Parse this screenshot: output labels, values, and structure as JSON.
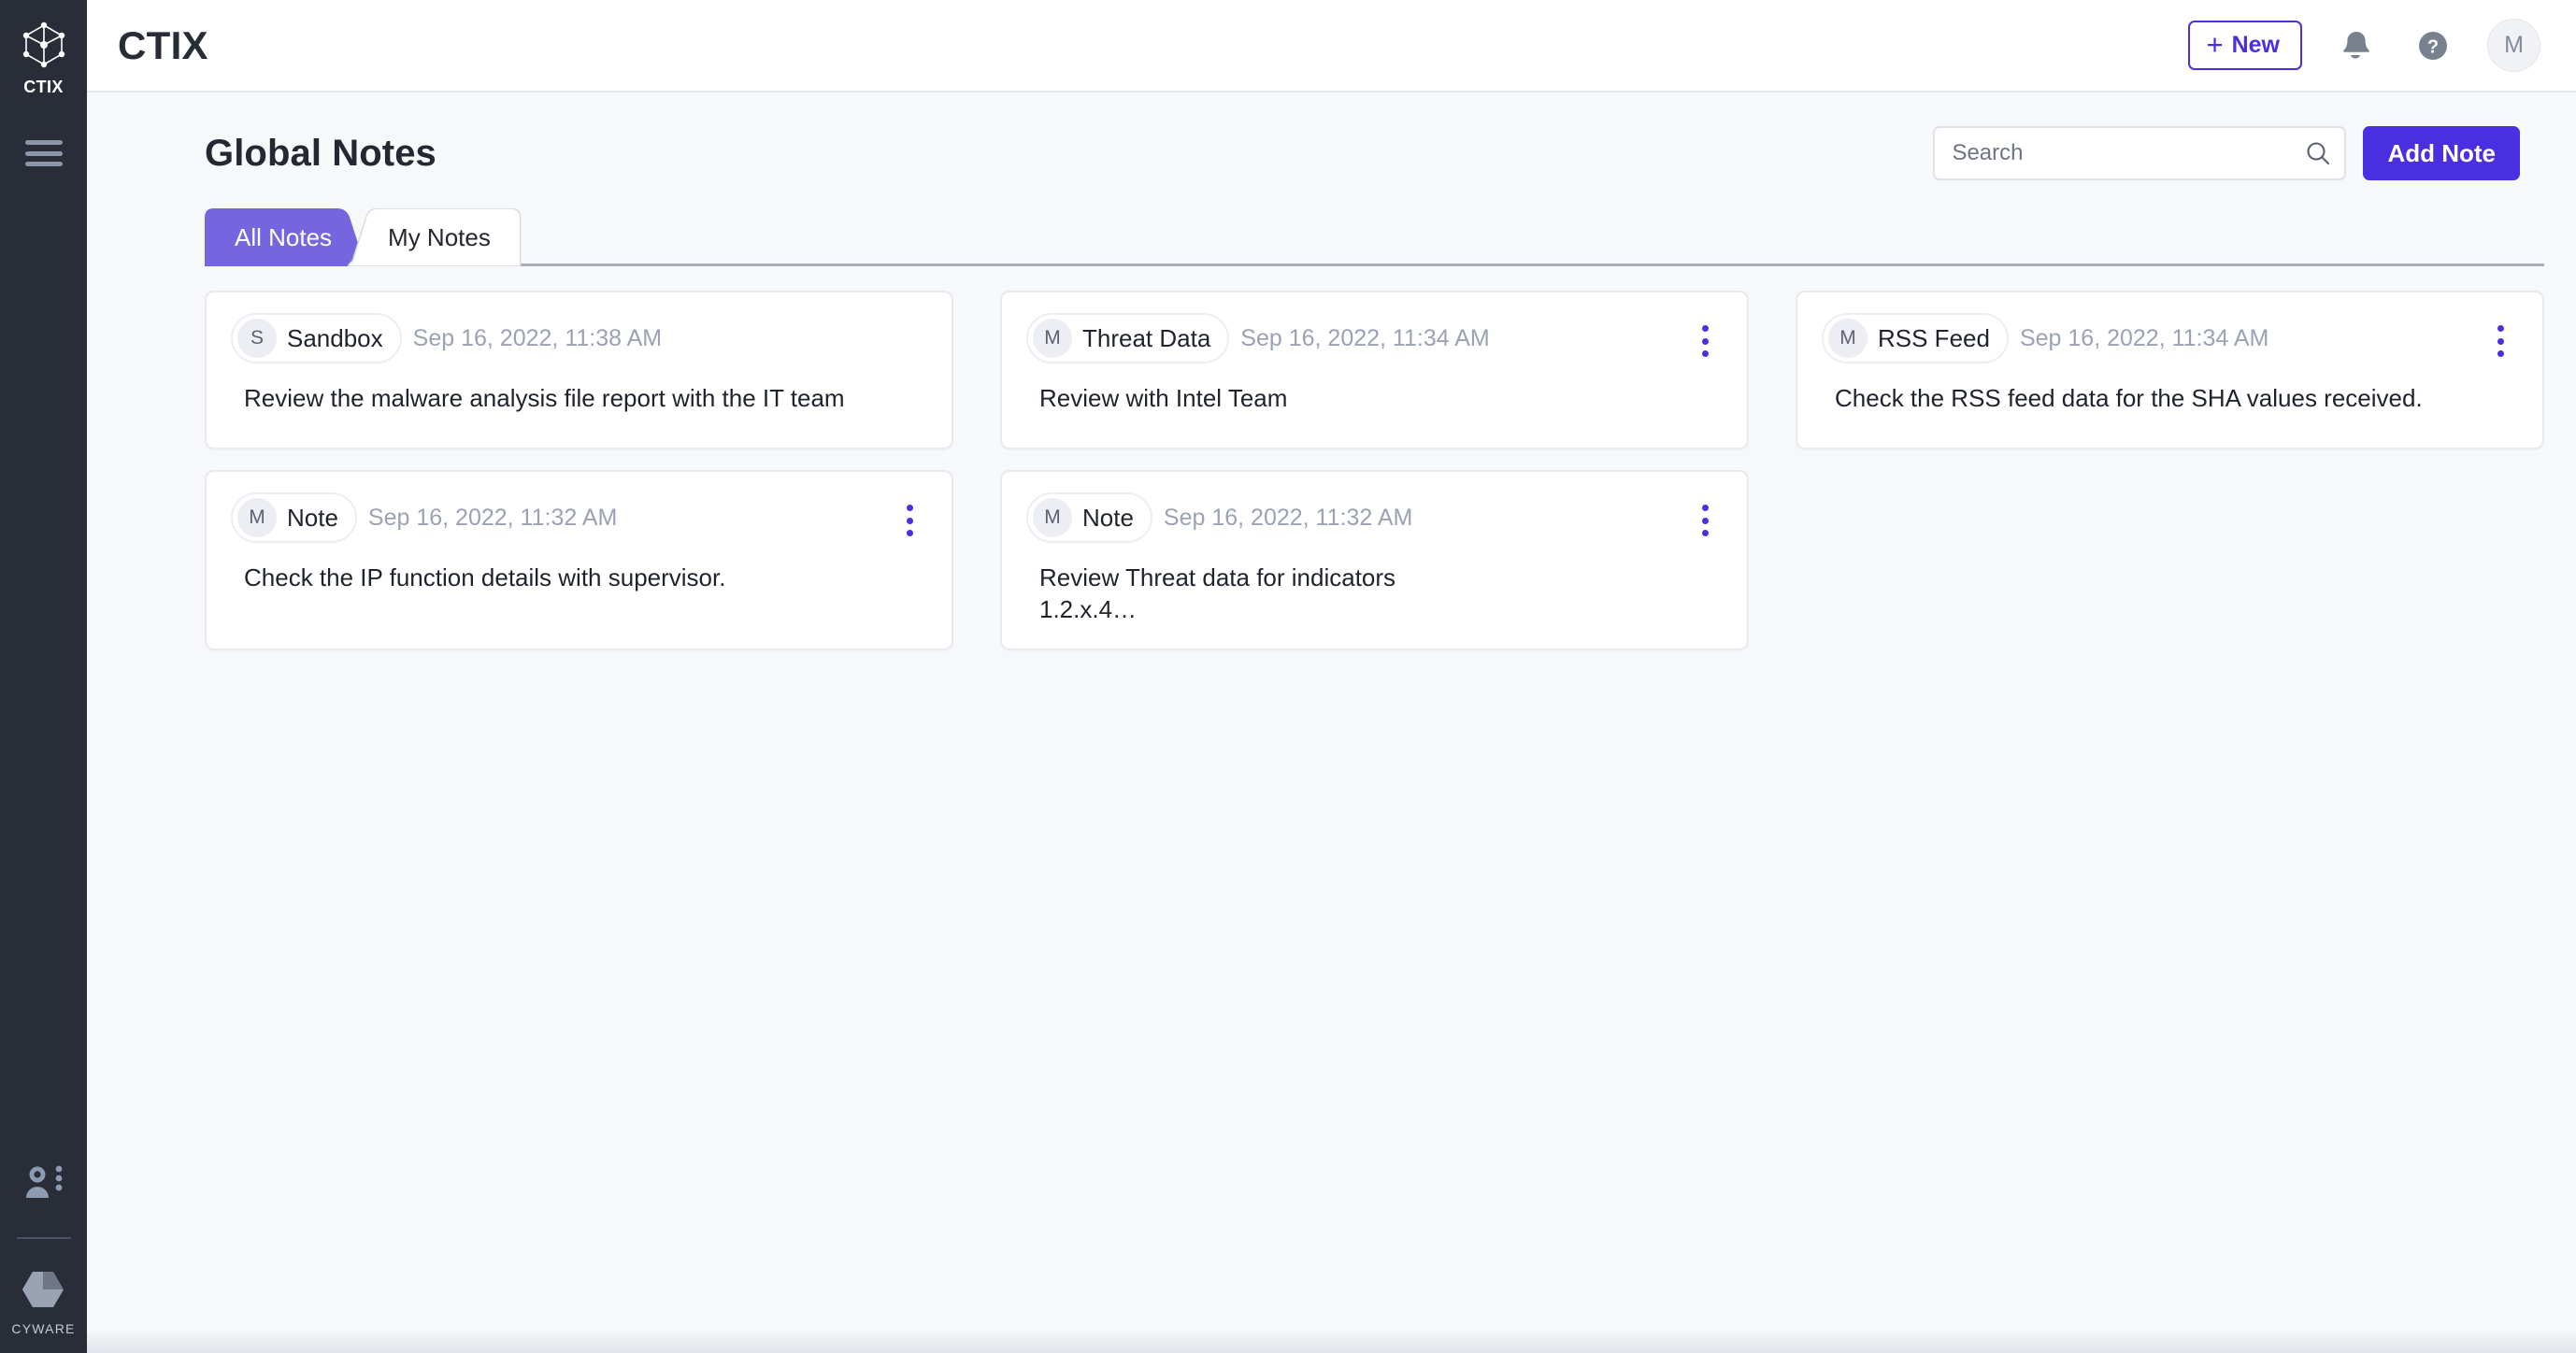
{
  "sidebar": {
    "logo_icon": "cube-network-icon",
    "logo_label": "CTIX",
    "menu_icon": "hamburger-menu-icon",
    "admin_icon": "user-settings-icon",
    "brand_icon": "cyware-logo-icon",
    "brand_label": "CYWARE"
  },
  "topbar": {
    "title": "CTIX",
    "new_button": {
      "plus": "+",
      "label": "New"
    },
    "notifications_icon": "bell-icon",
    "help_icon": "help-circle-icon",
    "avatar_initial": "M"
  },
  "page": {
    "title": "Global Notes",
    "search": {
      "value": "",
      "placeholder": "Search",
      "icon": "search-icon"
    },
    "add_note_label": "Add Note"
  },
  "tabs": [
    {
      "label": "All Notes",
      "active": true
    },
    {
      "label": "My Notes",
      "active": false
    }
  ],
  "notes": [
    {
      "avatar": "S",
      "owner": "Sandbox",
      "date": "Sep 16, 2022, 11:38 AM",
      "text": "Review the malware analysis file report with the IT team",
      "has_menu": false
    },
    {
      "avatar": "M",
      "owner": "Threat Data",
      "date": "Sep 16, 2022, 11:34 AM",
      "text": "Review with Intel Team",
      "has_menu": true
    },
    {
      "avatar": "M",
      "owner": "RSS Feed",
      "date": "Sep 16, 2022, 11:34 AM",
      "text": "Check the RSS feed data for the SHA values received.",
      "has_menu": true
    },
    {
      "avatar": "M",
      "owner": "Note",
      "date": "Sep 16, 2022, 11:32 AM",
      "text": "Check the IP function details with supervisor.",
      "has_menu": true
    },
    {
      "avatar": "M",
      "owner": "Note",
      "date": "Sep 16, 2022, 11:32 AM",
      "text": "Review Threat data for indicators\n1.2.x.4…",
      "has_menu": true
    }
  ],
  "colors": {
    "accent": "#4a2fe0",
    "tab_active": "#7566e0",
    "sidebar_bg": "#282d38",
    "page_bg": "#f7f8fa",
    "card_border": "#e8eaf0",
    "muted_text": "#9aa2b3"
  }
}
